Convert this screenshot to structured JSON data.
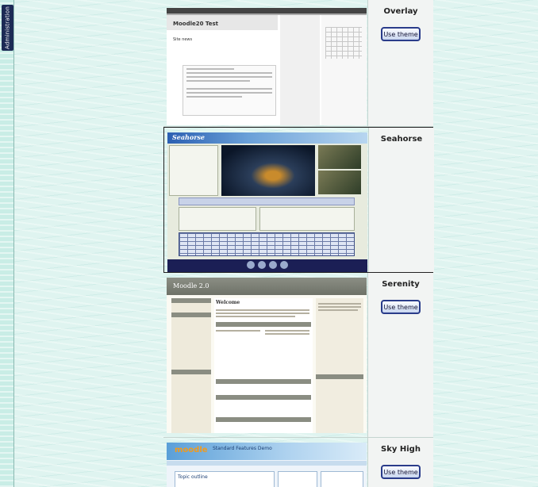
{
  "sidebar": {
    "admin_tab_label": "Administration"
  },
  "themes": [
    {
      "name": "Overlay",
      "button_label": "Use theme",
      "preview": {
        "site_title": "Moodle20 Test",
        "section": "Site news"
      }
    },
    {
      "name": "Seahorse",
      "button_label": "",
      "preview": {
        "logo_text": "Seahorse"
      }
    },
    {
      "name": "Serenity",
      "button_label": "Use theme",
      "preview": {
        "site_title": "Moodle 2.0",
        "welcome": "Welcome"
      }
    },
    {
      "name": "Sky High",
      "button_label": "Use theme",
      "preview": {
        "logo_text": "moodle",
        "site_title": "Standard Features Demo",
        "section": "Topic outline"
      }
    }
  ],
  "colors": {
    "button_border": "#2a3c8a",
    "admin_tab": "#1c2a55"
  }
}
